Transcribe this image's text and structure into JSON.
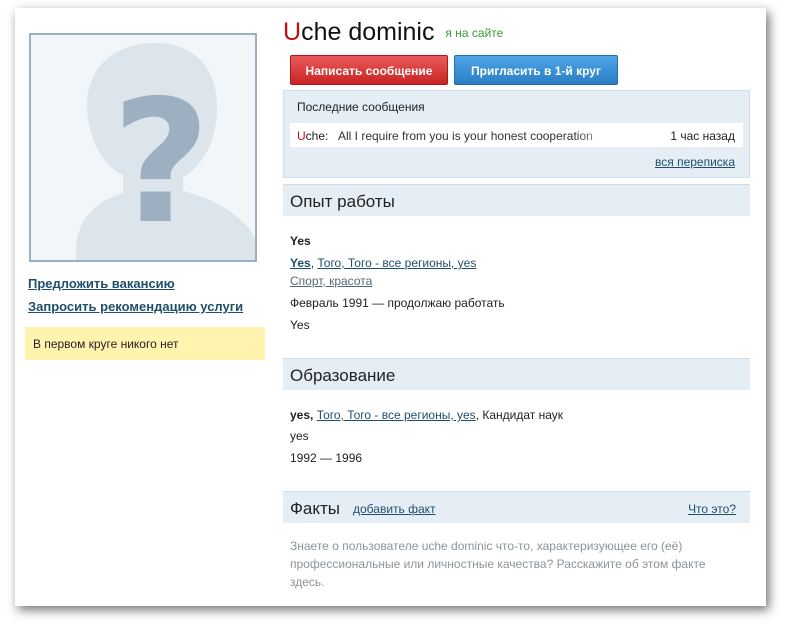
{
  "profile": {
    "name_first_letter": "U",
    "name_rest": "che dominic",
    "online_status": "я на сайте",
    "avatar_icon": "question-mark-silhouette-icon"
  },
  "actions": {
    "write_message": "Написать сообщение",
    "invite_circle": "Пригласить в 1-й круг"
  },
  "left": {
    "suggest_vacancy": "Предложить вакансию",
    "request_recommendation": "Запросить рекомендацию услуги",
    "circle_note": "В первом круге никого нет"
  },
  "messages": {
    "title": "Последние сообщения",
    "items": [
      {
        "sender_first": "U",
        "sender_rest": "che:",
        "text": "All I require from you is your honest cooperation",
        "time": "1 час назад"
      }
    ],
    "all_link": "вся переписка"
  },
  "experience": {
    "title": "Опыт работы",
    "position": "Yes",
    "company": "Yes",
    "location": "Того, Того - все регионы, yes",
    "sphere": "Спорт, красота",
    "period": "Февраль 1991 — продолжаю работать",
    "description": "Yes"
  },
  "education": {
    "title": "Образование",
    "institution": "yes,",
    "location": "Того, Того - все регионы, yes",
    "degree": ", Кандидат наук",
    "specialty": "yes",
    "period": "1992 — 1996"
  },
  "facts": {
    "title": "Факты",
    "add_link": "добавить факт",
    "what_link": "Что это?",
    "hint": "Знаете о пользователе uche dominic что-то, характеризующее его (её) профессиональные или личностные качества? Расскажите об этом факте здесь."
  },
  "colors": {
    "accent_red": "#c01010",
    "online_green": "#3a9a3a",
    "link_blue": "#1f4f6b",
    "section_bg": "#e5eef5",
    "note_bg": "#fff3ad"
  }
}
